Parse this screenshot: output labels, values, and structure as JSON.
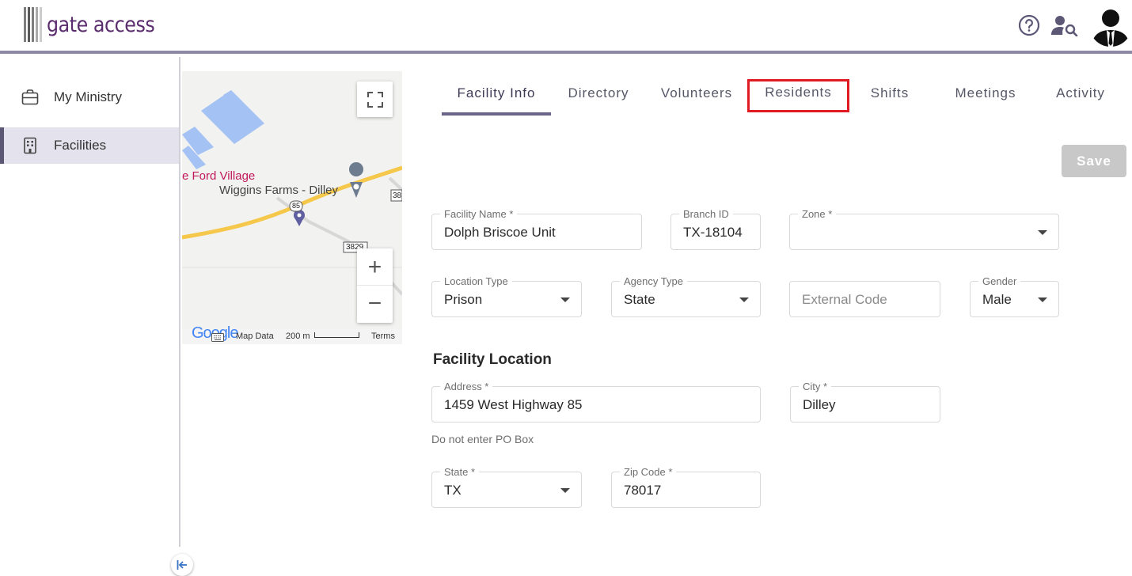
{
  "app": {
    "logo_text": "gate access"
  },
  "sidebar": {
    "items": [
      {
        "label": "My Ministry",
        "icon": "briefcase-icon"
      },
      {
        "label": "Facilities",
        "icon": "building-icon"
      }
    ]
  },
  "map": {
    "village_label": "e Ford Village",
    "farms_label": "Wiggins Farms - Dilley",
    "route_85": "85",
    "route_3829": "3829",
    "route_38": "38",
    "google_label": "Google",
    "map_data": "Map Data",
    "scale": "200 m",
    "terms": "Terms",
    "zoom_in": "+",
    "zoom_out": "−"
  },
  "tabs": [
    {
      "label": "Facility Info"
    },
    {
      "label": "Directory"
    },
    {
      "label": "Volunteers"
    },
    {
      "label": "Residents"
    },
    {
      "label": "Shifts"
    },
    {
      "label": "Meetings"
    },
    {
      "label": "Activity"
    }
  ],
  "active_tab": "Facility Info",
  "marked_tab": "Residents",
  "save_label": "Save",
  "form": {
    "facility_name": {
      "label": "Facility Name *",
      "value": "Dolph Briscoe Unit"
    },
    "branch_id": {
      "label": "Branch ID",
      "value": "TX-18104"
    },
    "zone": {
      "label": "Zone *",
      "value": ""
    },
    "location_type": {
      "label": "Location Type",
      "value": "Prison"
    },
    "agency_type": {
      "label": "Agency Type",
      "value": "State"
    },
    "external_code": {
      "placeholder": "External Code",
      "value": ""
    },
    "gender": {
      "label": "Gender",
      "value": "Male"
    },
    "location_title": "Facility Location",
    "address": {
      "label": "Address *",
      "value": "1459 West Highway 85"
    },
    "city": {
      "label": "City *",
      "value": "Dilley"
    },
    "address_helper": "Do not enter PO Box",
    "state": {
      "label": "State *",
      "value": "TX"
    },
    "zip": {
      "label": "Zip Code *",
      "value": "78017"
    }
  },
  "colors": {
    "brand": "#5b2d6e",
    "header_border": "#8d88a6",
    "tab_active": "#6a6688",
    "highlight": "#e01b24",
    "save_disabled": "#c8c8c8",
    "sidebar_active_bg": "#e4e2ec"
  }
}
